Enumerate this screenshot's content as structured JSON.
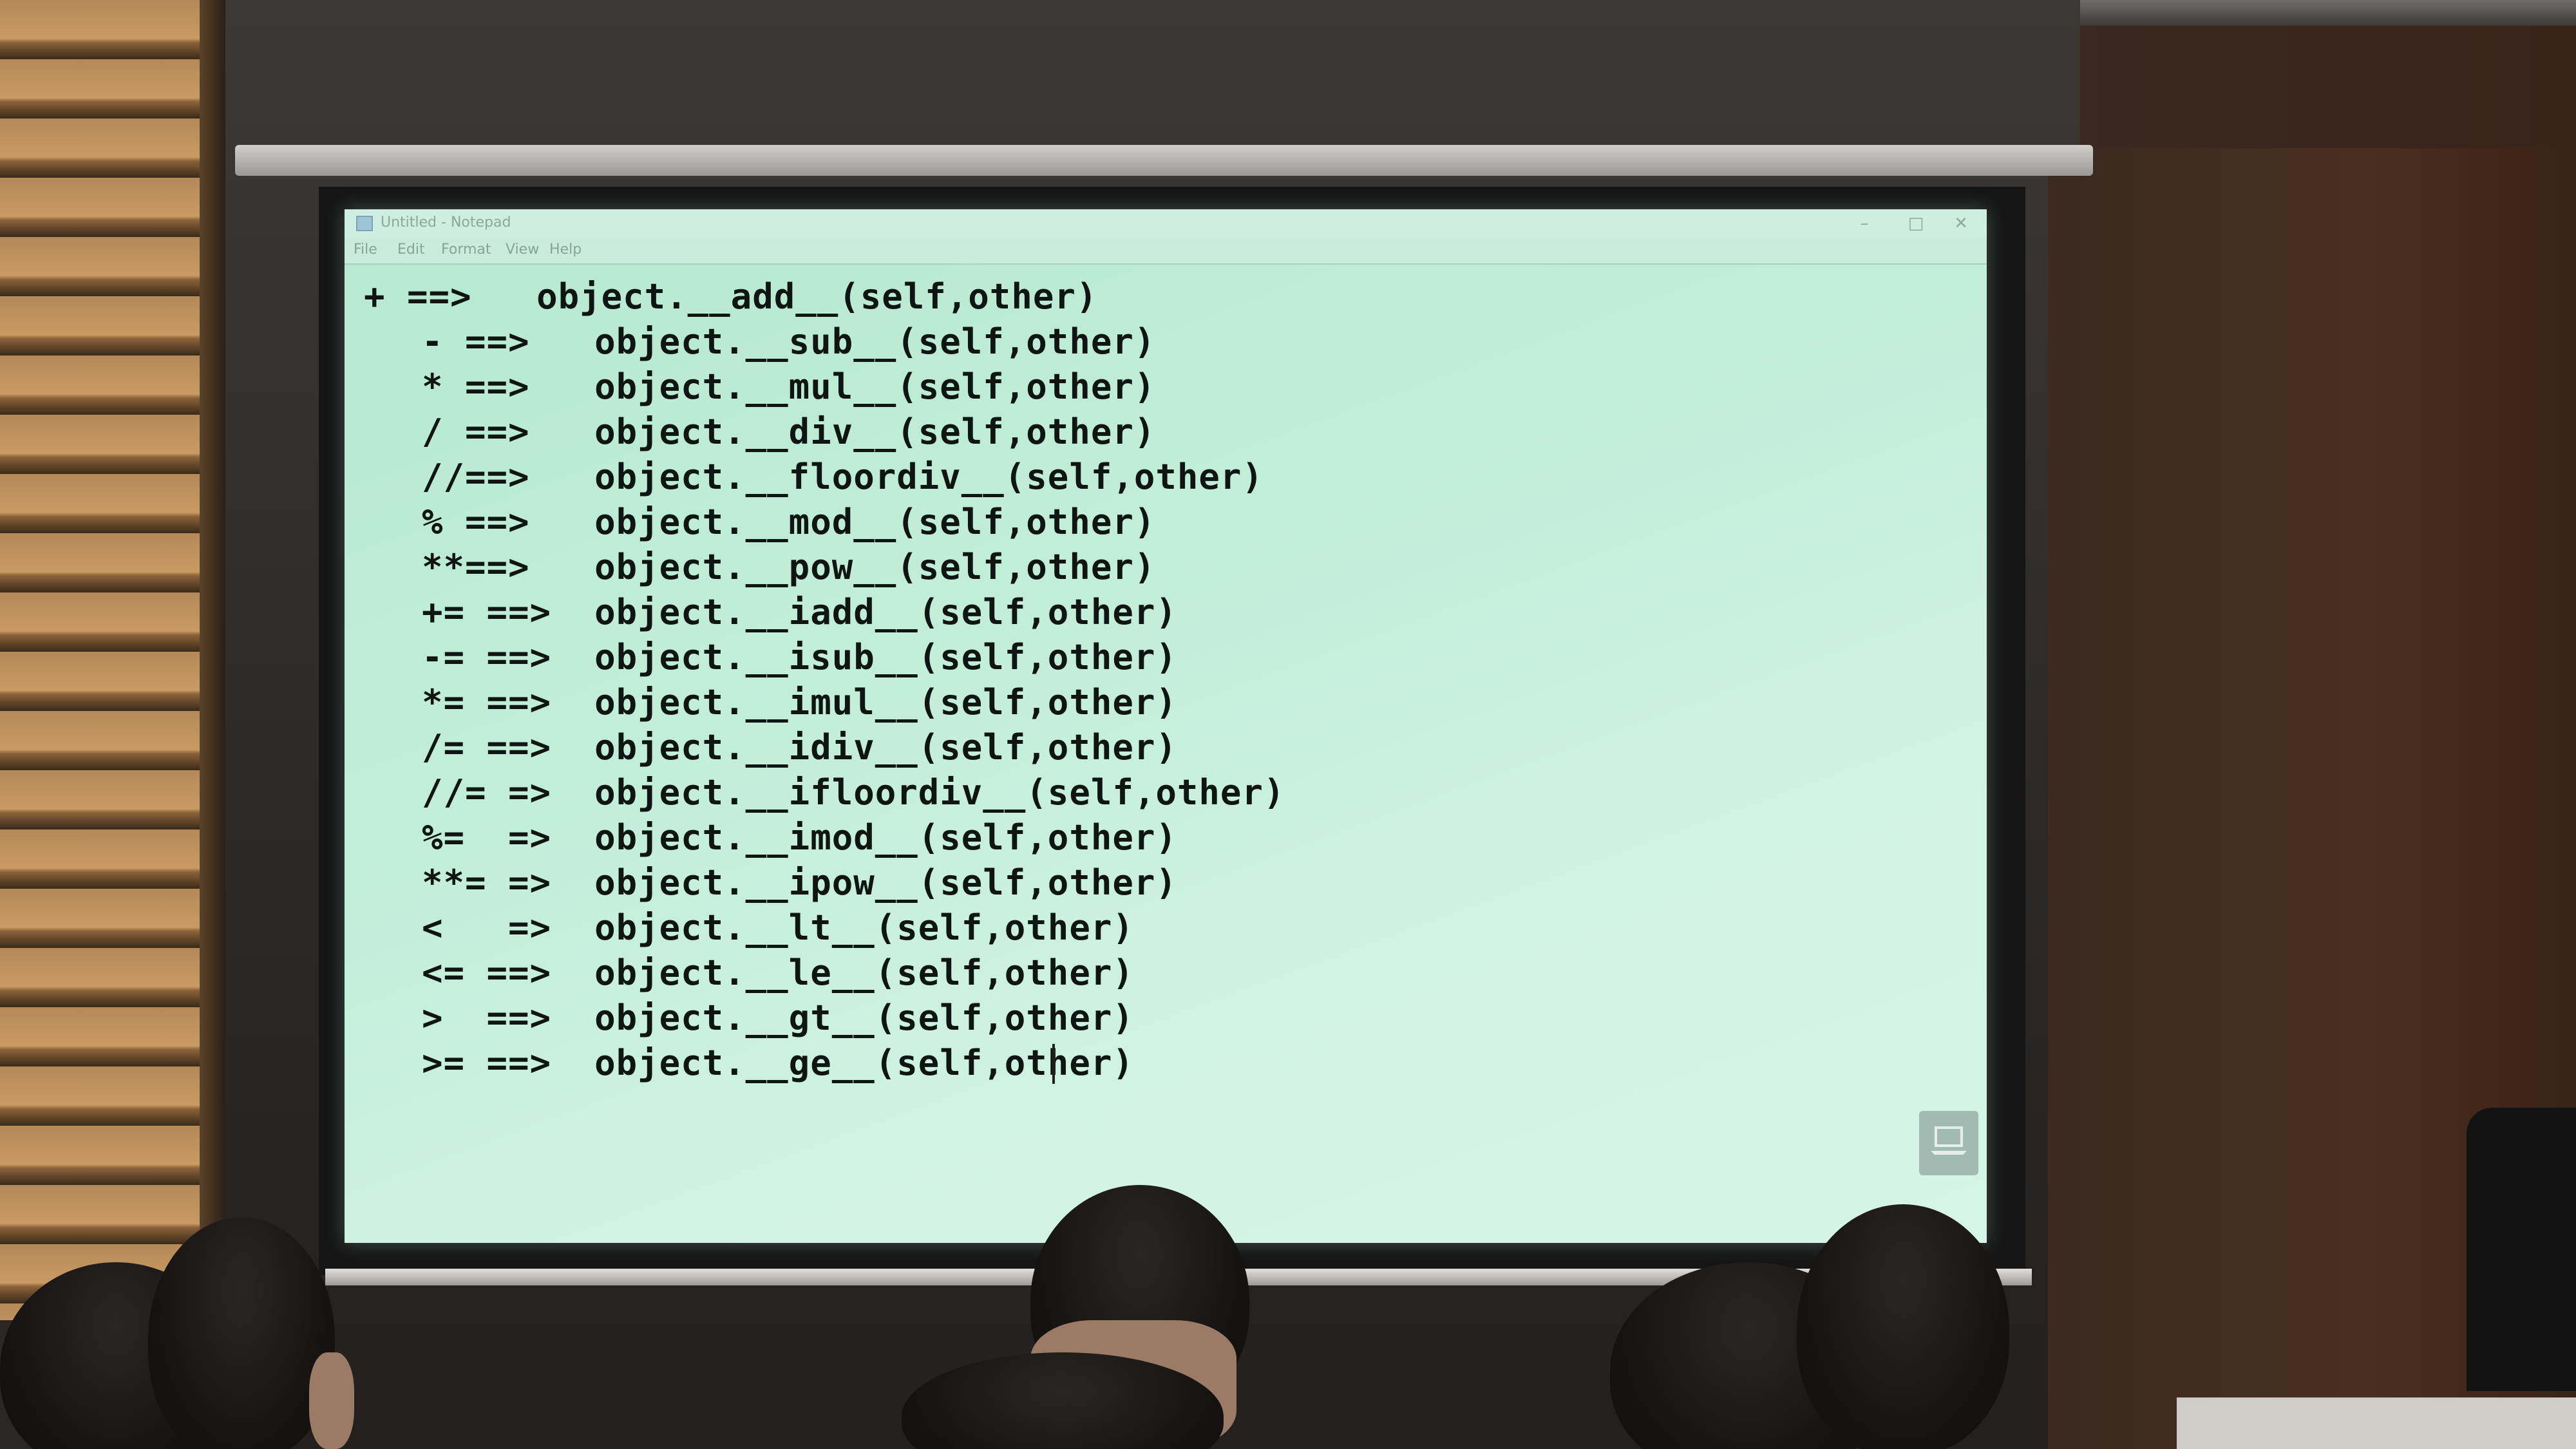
{
  "window": {
    "title": "Untitled - Notepad",
    "controls": {
      "minimize": "–",
      "maximize": "□",
      "close": "✕"
    },
    "menu": [
      "File",
      "Edit",
      "Format",
      "View",
      "Help"
    ]
  },
  "editor": {
    "lines": [
      "+ ==>   object.__add__(self,other)",
      "- ==>   object.__sub__(self,other)",
      "* ==>   object.__mul__(self,other)",
      "/ ==>   object.__div__(self,other)",
      "//==>   object.__floordiv__(self,other)",
      "% ==>   object.__mod__(self,other)",
      "**==>   object.__pow__(self,other)",
      "+= ==>  object.__iadd__(self,other)",
      "-= ==>  object.__isub__(self,other)",
      "*= ==>  object.__imul__(self,other)",
      "/= ==>  object.__idiv__(self,other)",
      "//= =>  object.__ifloordiv__(self,other)",
      "%=  =>  object.__imod__(self,other)",
      "**= =>  object.__ipow__(self,other)",
      "<   =>  object.__lt__(self,other)",
      "<= ==>  object.__le__(self,other)",
      ">  ==>  object.__gt__(self,other)",
      ">= ==>  object.__ge__(self,other)"
    ]
  },
  "icons": {
    "presenter": "laptop-icon",
    "app": "notepad-icon"
  },
  "colors": {
    "screen_tint": "#c4eedb",
    "text": "#0f1513"
  }
}
